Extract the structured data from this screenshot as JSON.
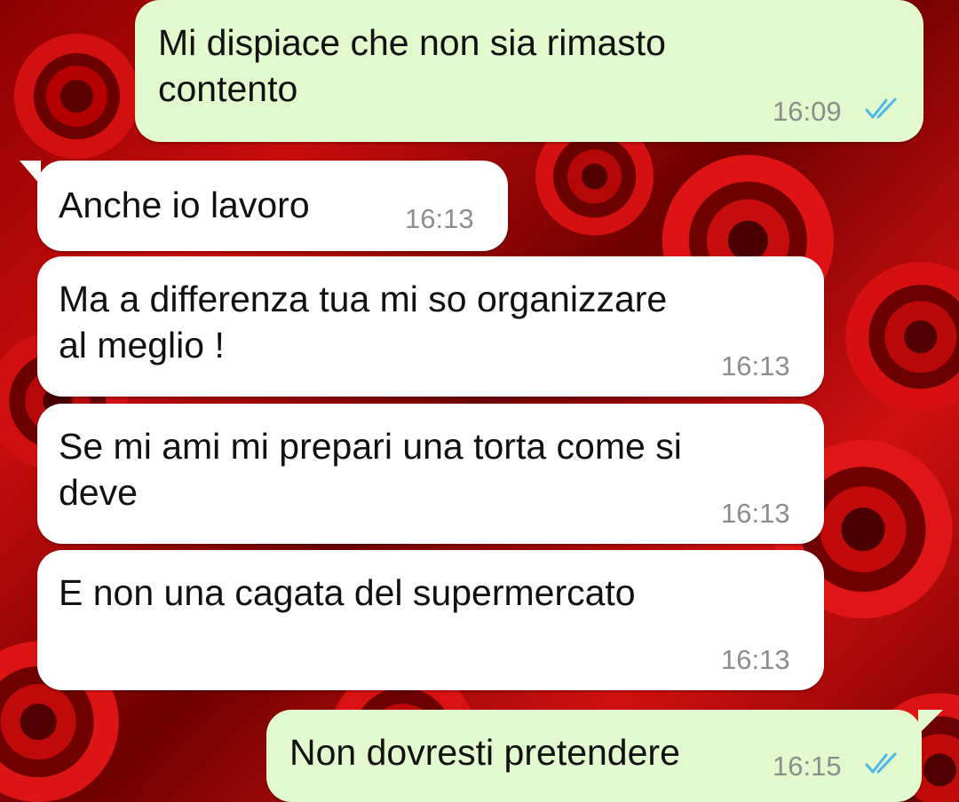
{
  "chat": {
    "tick_color": "#4fb6ec",
    "outgoing_bubble_color": "#e2f8cd",
    "incoming_bubble_color": "#ffffff",
    "wallpaper": "red-roses",
    "messages": [
      {
        "direction": "outgoing",
        "text": "Mi dispiace che non sia rimasto\ncontento",
        "time": "16:09",
        "status": "read-double-check-icon"
      },
      {
        "direction": "incoming",
        "text": "Anche io lavoro",
        "time": "16:13"
      },
      {
        "direction": "incoming",
        "text": "Ma a differenza tua mi so organizzare\nal meglio !",
        "time": "16:13"
      },
      {
        "direction": "incoming",
        "text": "Se mi ami mi prepari una torta come si\ndeve",
        "time": "16:13"
      },
      {
        "direction": "incoming",
        "text": "E non una cagata del supermercato",
        "time": "16:13"
      },
      {
        "direction": "outgoing",
        "text": "Non dovresti pretendere",
        "time": "16:15",
        "status": "read-double-check-icon"
      }
    ]
  }
}
